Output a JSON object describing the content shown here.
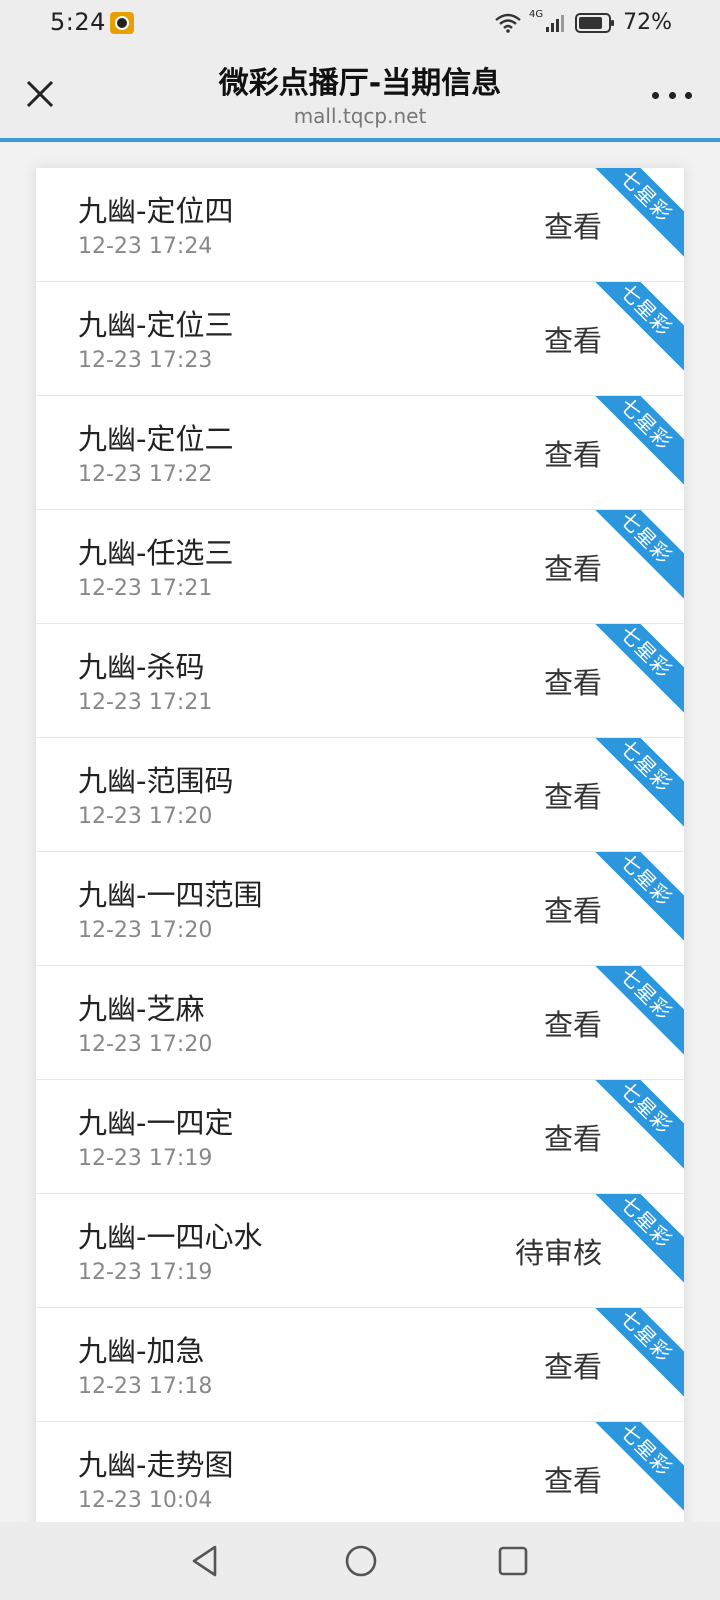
{
  "status_bar": {
    "time": "5:24",
    "network": "4G",
    "battery": "72%"
  },
  "header": {
    "title": "微彩点播厅-当期信息",
    "url": "mall.tqcp.net"
  },
  "colors": {
    "accent": "#3d9ad6",
    "ribbon": "#2c97dd"
  },
  "list": {
    "items": [
      {
        "title": "九幽-定位四",
        "time": "12-23 17:24",
        "action": "查看",
        "tag": "七星彩"
      },
      {
        "title": "九幽-定位三",
        "time": "12-23 17:23",
        "action": "查看",
        "tag": "七星彩"
      },
      {
        "title": "九幽-定位二",
        "time": "12-23 17:22",
        "action": "查看",
        "tag": "七星彩"
      },
      {
        "title": "九幽-任选三",
        "time": "12-23 17:21",
        "action": "查看",
        "tag": "七星彩"
      },
      {
        "title": "九幽-杀码",
        "time": "12-23 17:21",
        "action": "查看",
        "tag": "七星彩"
      },
      {
        "title": "九幽-范围码",
        "time": "12-23 17:20",
        "action": "查看",
        "tag": "七星彩"
      },
      {
        "title": "九幽-一四范围",
        "time": "12-23 17:20",
        "action": "查看",
        "tag": "七星彩"
      },
      {
        "title": "九幽-芝麻",
        "time": "12-23 17:20",
        "action": "查看",
        "tag": "七星彩"
      },
      {
        "title": "九幽-一四定",
        "time": "12-23 17:19",
        "action": "查看",
        "tag": "七星彩"
      },
      {
        "title": "九幽-一四心水",
        "time": "12-23 17:19",
        "action": "待审核",
        "tag": "七星彩"
      },
      {
        "title": "九幽-加急",
        "time": "12-23 17:18",
        "action": "查看",
        "tag": "七星彩"
      },
      {
        "title": "九幽-走势图",
        "time": "12-23 10:04",
        "action": "查看",
        "tag": "七星彩"
      }
    ]
  }
}
